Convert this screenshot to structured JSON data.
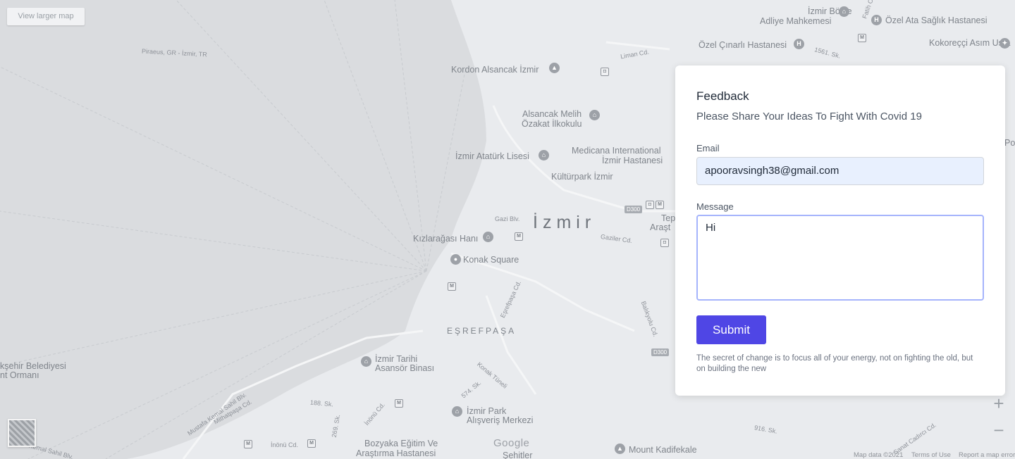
{
  "map": {
    "view_larger_label": "View larger map",
    "zoom_in_label": "+",
    "zoom_out_label": "−",
    "google_logo": "Google",
    "footer": {
      "map_data": "Map data ©2021",
      "terms": "Terms of Use",
      "report": "Report a map error"
    },
    "labels": {
      "city": "İzmir",
      "district": "EŞREFPAŞA",
      "ferry_route": "Piraeus, GR - İzmir, TR",
      "izmir_bolge_1": "İzmir Bölge",
      "izmir_bolge_2": "Adliye Mahkemesi",
      "ozel_ata": "Özel Ata Sağlık Hastanesi",
      "ozel_cinarli": "Özel Çınarlı Hastanesi",
      "kokorecci": "Kokoreççi Asım Usta",
      "kordon": "Kordon Alsancak İzmir",
      "alsancak_1": "Alsancak Melih",
      "alsancak_2": "Özakat İlkokulu",
      "ataturk_lisesi": "İzmir Atatürk Lisesi",
      "medicana_1": "Medicana International",
      "medicana_2": "İzmir Hastanesi",
      "kulturpark": "Kültürpark İzmir",
      "kizlaragasi": "Kızlarağası Hanı",
      "konak_square": "Konak Square",
      "tarihi_1": "İzmir Tarihi",
      "tarihi_2": "Asansör Binası",
      "park_1": "İzmir Park",
      "park_2": "Alışveriş Merkezi",
      "bozyaka_1": "Bozyaka Eğitim Ve",
      "bozyaka_2": "Araştırma Hastanesi",
      "mount_kadifekale": "Mount Kadifekale",
      "belediye_1": "kşehir Belediyesi",
      "belediye_2": "nt Ormanı",
      "sehitler": "Şehitler",
      "tep_1": "Tep",
      "tep_2": "Araşt",
      "po": "Po",
      "road_liman": "Liman Cd.",
      "road_1561": "1561. Sk.",
      "road_gazi": "Gazi Blv.",
      "road_gaziler": "Gaziler Cd.",
      "road_esrefpasa": "Eşrefpaşa Cd.",
      "road_balikyolu": "Balıkyolu Cd.",
      "road_konak_tuneli": "Konak Tüneli",
      "road_574": "574. Sk.",
      "road_188": "188. Sk.",
      "road_inonu": "İnönü Cd.",
      "road_inonu_2": "İnönü Cd.",
      "road_269": "269. Sk.",
      "road_mustafa": "Mustafa Kemal Sahil Blv.",
      "road_mithatpasa": "Mithatpaşa Cd.",
      "road_sahil": "Kemal Sahil Blv.",
      "road_916": "916. Sk.",
      "road_cadirci": "Sanat Cadırcı Cd.",
      "road_fatih": "Fatih Cd.",
      "shield_d300": "D300"
    }
  },
  "feedback": {
    "title": "Feedback",
    "subtitle": "Please Share Your Ideas To Fight With Covid 19",
    "email_label": "Email",
    "email_value": "apooravsingh38@gmail.com",
    "message_label": "Message",
    "message_value": "Hi",
    "submit_label": "Submit",
    "quote": "The secret of change is to focus all of your energy, not on fighting the old, but on building the new"
  }
}
